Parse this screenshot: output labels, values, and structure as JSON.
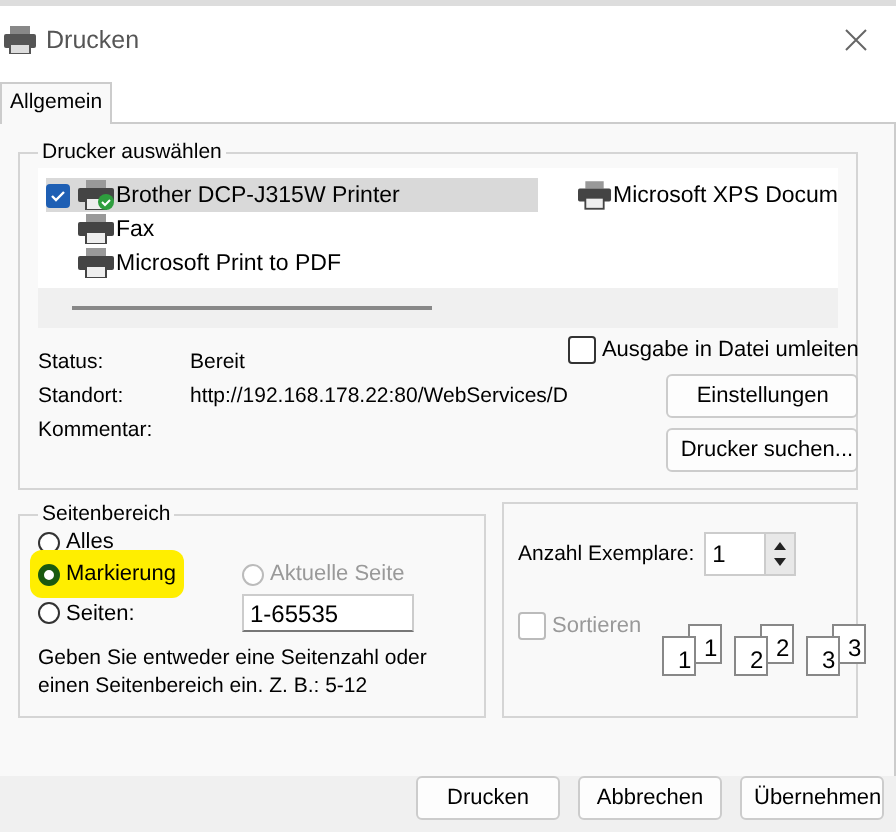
{
  "window": {
    "title": "Drucken"
  },
  "tabs": [
    {
      "label": "Allgemein",
      "selected": true
    }
  ],
  "printer_group": {
    "title": "Drucker auswählen",
    "printers": [
      {
        "name": "Brother DCP-J315W Printer",
        "selected": true,
        "default": true,
        "ready": true
      },
      {
        "name": "Fax",
        "selected": false,
        "default": false,
        "ready": false
      },
      {
        "name": "Microsoft Print to PDF",
        "selected": false,
        "default": false,
        "ready": false
      },
      {
        "name": "Microsoft XPS Docum",
        "selected": false,
        "default": false,
        "ready": false
      }
    ],
    "info": [
      {
        "label": "Status:",
        "value": "Bereit"
      },
      {
        "label": "Standort:",
        "value": "http://192.168.178.22:80/WebServices/D"
      },
      {
        "label": "Kommentar:"
      }
    ],
    "print_to_file": {
      "label": "Ausgabe in Datei umleiten",
      "checked": false
    },
    "buttons": [
      "Einstellungen",
      "Drucker suchen..."
    ]
  },
  "range_group": {
    "title": "Seitenbereich",
    "options": [
      {
        "label": "Alles",
        "selected": false,
        "disabled": false,
        "highlighted": false
      },
      {
        "label": "Markierung",
        "selected": true,
        "disabled": false,
        "highlighted": true
      },
      {
        "label": "Aktuelle Seite",
        "selected": false,
        "disabled": true,
        "highlighted": false
      },
      {
        "label": "Seiten:",
        "selected": false,
        "disabled": false,
        "highlighted": false
      }
    ],
    "pages_value": "1-65535",
    "hint": "Geben Sie entweder eine Seitenzahl oder einen Seitenbereich ein. Z. B.: 5-12"
  },
  "copies_group": {
    "copies_label": "Anzahl Exemplare:",
    "copies_value": "1",
    "collate": {
      "label": "Sortieren",
      "checked": false,
      "disabled": true
    },
    "collate_sets": [
      {
        "front": "1",
        "back": "1"
      },
      {
        "front": "2",
        "back": "2"
      },
      {
        "front": "3",
        "back": "3"
      }
    ]
  },
  "buttons": [
    "Drucken",
    "Abbrechen",
    "Übernehmen"
  ]
}
